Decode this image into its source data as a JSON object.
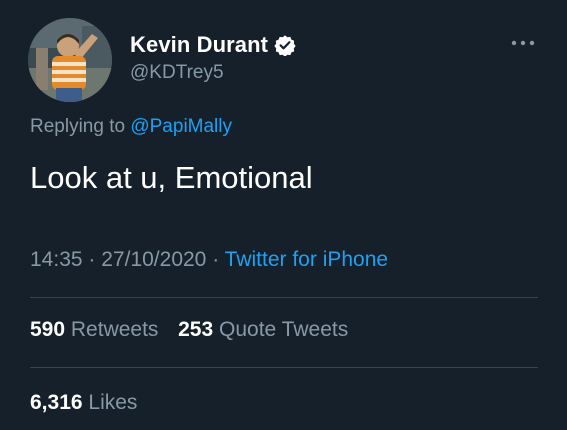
{
  "author": {
    "display_name": "Kevin Durant",
    "handle": "@KDTrey5",
    "verified_icon": "verified-badge-icon",
    "avatar": "profile-photo"
  },
  "reply": {
    "prefix": "Replying to",
    "to_handle": "@PapiMally"
  },
  "tweet": {
    "text": "Look at u, Emotional"
  },
  "meta": {
    "time": "14:35",
    "separator": "·",
    "date": "27/10/2020",
    "source": "Twitter for iPhone"
  },
  "stats": {
    "retweets_count": "590",
    "retweets_label": "Retweets",
    "quotes_count": "253",
    "quotes_label": "Quote Tweets",
    "likes_count": "6,316",
    "likes_label": "Likes"
  },
  "colors": {
    "background": "#15202b",
    "primary_text": "#ffffff",
    "secondary_text": "#8899a6",
    "accent": "#1da1f2",
    "divider": "#38444d"
  }
}
